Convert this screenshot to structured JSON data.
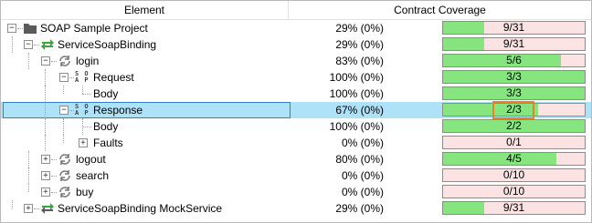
{
  "header": {
    "element_label": "Element",
    "coverage_label": "Contract Coverage"
  },
  "colors": {
    "covered": "#86e57f",
    "uncovered": "#fbe3e4",
    "selection": "#aee2f8",
    "highlight": "#e6822a"
  },
  "rows": [
    {
      "label": "SOAP Sample Project",
      "icon": "folder-icon",
      "expander": "minus",
      "percent": "29% (0%)",
      "coverage": "9/31",
      "fraction": 0.29
    },
    {
      "label": "ServiceSoapBinding",
      "icon": "binding-arrows-icon",
      "expander": "minus",
      "percent": "29% (0%)",
      "coverage": "9/31",
      "fraction": 0.29
    },
    {
      "label": "login",
      "icon": "operation-refresh-icon",
      "expander": "minus",
      "percent": "83% (0%)",
      "coverage": "5/6",
      "fraction": 0.83
    },
    {
      "label": "Request",
      "icon": "soap-icon",
      "expander": "minus",
      "percent": "100% (0%)",
      "coverage": "3/3",
      "fraction": 1.0
    },
    {
      "label": "Body",
      "icon": "",
      "expander": "none",
      "percent": "100% (0%)",
      "coverage": "3/3",
      "fraction": 1.0
    },
    {
      "label": "Response",
      "icon": "soap-icon",
      "expander": "minus",
      "percent": "67% (0%)",
      "coverage": "2/3",
      "fraction": 0.67,
      "selected": true
    },
    {
      "label": "Body",
      "icon": "",
      "expander": "none",
      "percent": "100% (0%)",
      "coverage": "2/2",
      "fraction": 1.0
    },
    {
      "label": "Faults",
      "icon": "",
      "expander": "plus",
      "percent": "0% (0%)",
      "coverage": "0/1",
      "fraction": 0.0
    },
    {
      "label": "logout",
      "icon": "operation-refresh-icon",
      "expander": "plus",
      "percent": "80% (0%)",
      "coverage": "4/5",
      "fraction": 0.8
    },
    {
      "label": "search",
      "icon": "operation-refresh-icon",
      "expander": "plus",
      "percent": "0% (0%)",
      "coverage": "0/10",
      "fraction": 0.0
    },
    {
      "label": "buy",
      "icon": "operation-refresh-icon",
      "expander": "plus",
      "percent": "0% (0%)",
      "coverage": "0/10",
      "fraction": 0.0
    },
    {
      "label": "ServiceSoapBinding MockService",
      "icon": "mock-service-arrows-icon",
      "expander": "plus",
      "percent": "29% (0%)",
      "coverage": "9/31",
      "fraction": 0.29
    }
  ]
}
